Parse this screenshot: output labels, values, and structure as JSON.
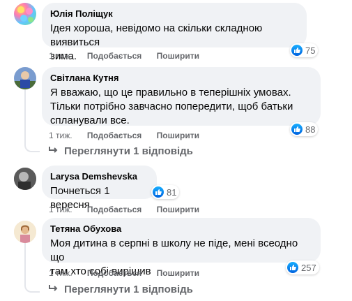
{
  "comments": [
    {
      "author": "Юлія Поліщук",
      "text_lines": [
        "Ідея хороша, невідомо на скільки складною виявиться",
        "зима."
      ],
      "time": "1 тиж.",
      "like_label": "Подобається",
      "share_label": "Поширити",
      "reactions": "75"
    },
    {
      "author": "Світлана Кутня",
      "text_lines": [
        "Я вважаю, що це правильно в теперішніх умовах.",
        "Тільки потрібно завчасно попередити, щоб батьки",
        "спланували все."
      ],
      "time": "1 тиж.",
      "like_label": "Подобається",
      "share_label": "Поширити",
      "reactions": "88",
      "view_replies": "Переглянути 1 відповідь"
    },
    {
      "author": "Larysa Demshevska",
      "text_lines": [
        "Почнеться 1 вересня"
      ],
      "time": "1 тиж.",
      "like_label": "Подобається",
      "share_label": "Поширити",
      "reactions": "81"
    },
    {
      "author": "Тетяна Обухова",
      "text_lines": [
        "Моя дитина в серпні в школу не піде, мені всеодно що",
        "там хто собі вирішив"
      ],
      "time": "1 тиж.",
      "like_label": "Подобається",
      "share_label": "Поширити",
      "reactions": "257",
      "view_replies": "Переглянути 1 відповідь"
    }
  ],
  "colors": {
    "bubble": "#f0f2f5",
    "secondary_text": "#65676b",
    "like_blue": "#1877f2"
  }
}
